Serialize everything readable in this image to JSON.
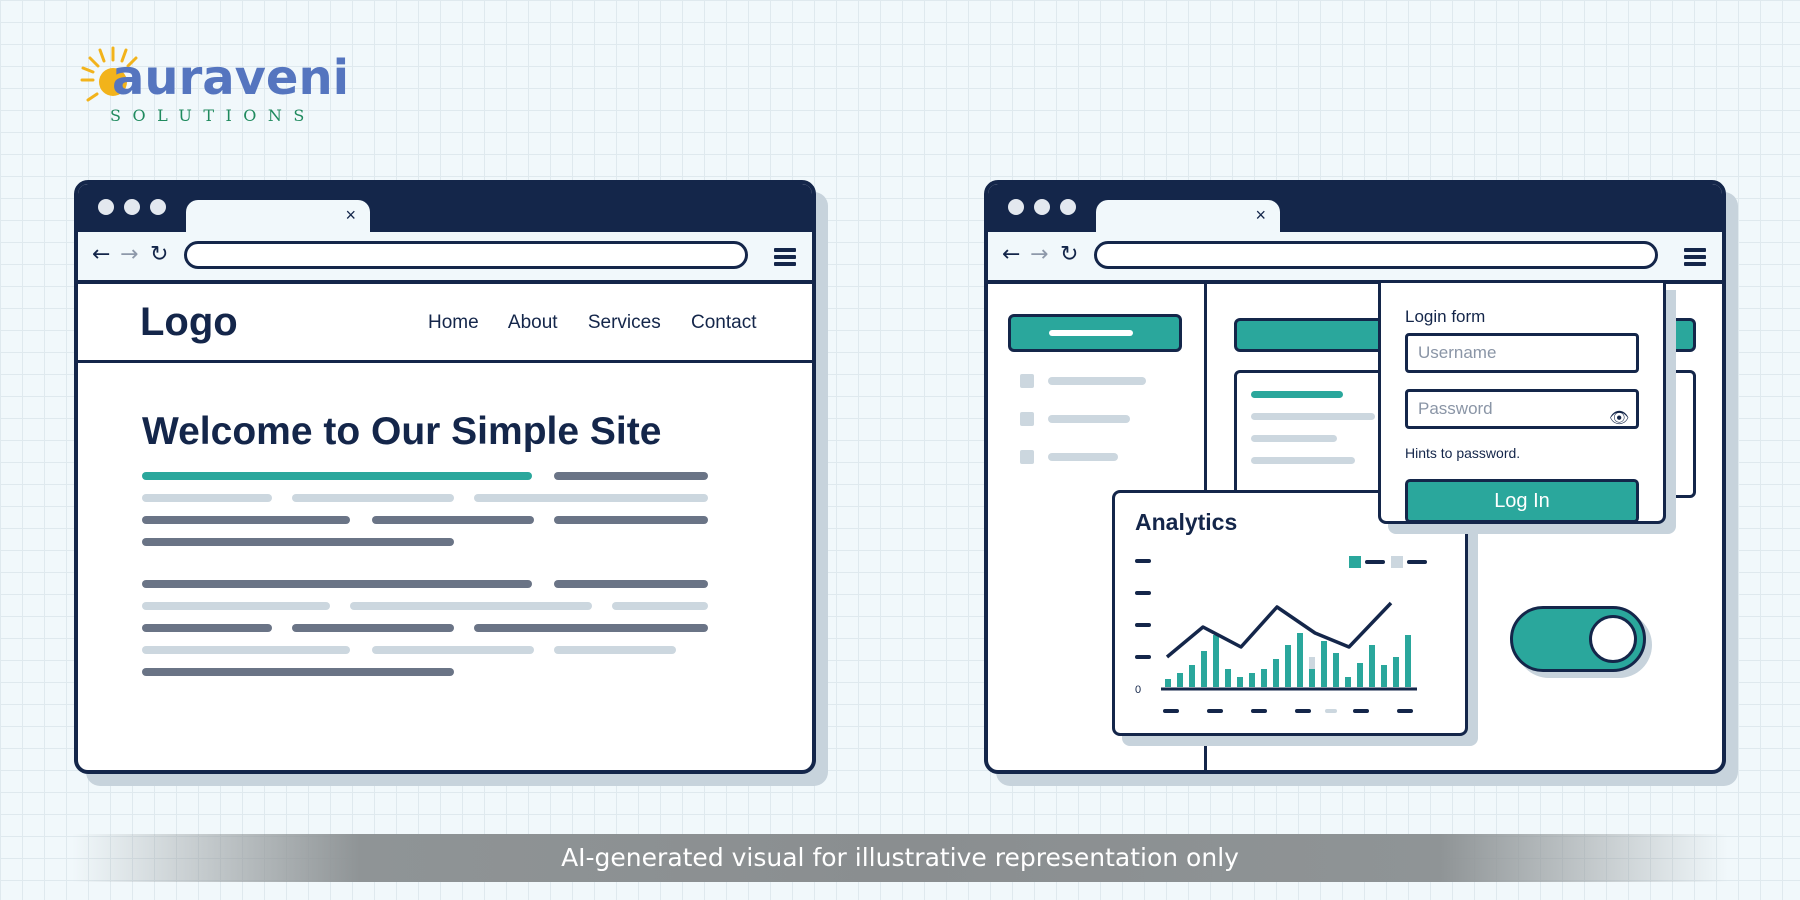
{
  "brand": {
    "name": "auraveni",
    "tagline": "SOLUTIONS"
  },
  "left_window": {
    "tab_close": "×",
    "site_logo": "Logo",
    "nav": [
      "Home",
      "About",
      "Services",
      "Contact"
    ],
    "hero_title": "Welcome to Our Simple Site"
  },
  "right_window": {
    "tab_close": "×",
    "analytics": {
      "title": "Analytics",
      "axis_zero": "0"
    },
    "login": {
      "title": "Login form",
      "username_placeholder": "Username",
      "password_placeholder": "Password",
      "hint": "Hints to password.",
      "button": "Log In"
    }
  },
  "disclaimer": "AI-generated visual for illustrative representation only",
  "colors": {
    "navy": "#14264a",
    "teal": "#2aa79c",
    "brand_blue": "#5575bf",
    "brand_green": "#1f8a5e",
    "sun": "#f2b31b"
  },
  "icons": [
    "back-arrow-icon",
    "forward-arrow-icon",
    "reload-icon",
    "hamburger-menu-icon",
    "close-icon",
    "eye-icon"
  ]
}
